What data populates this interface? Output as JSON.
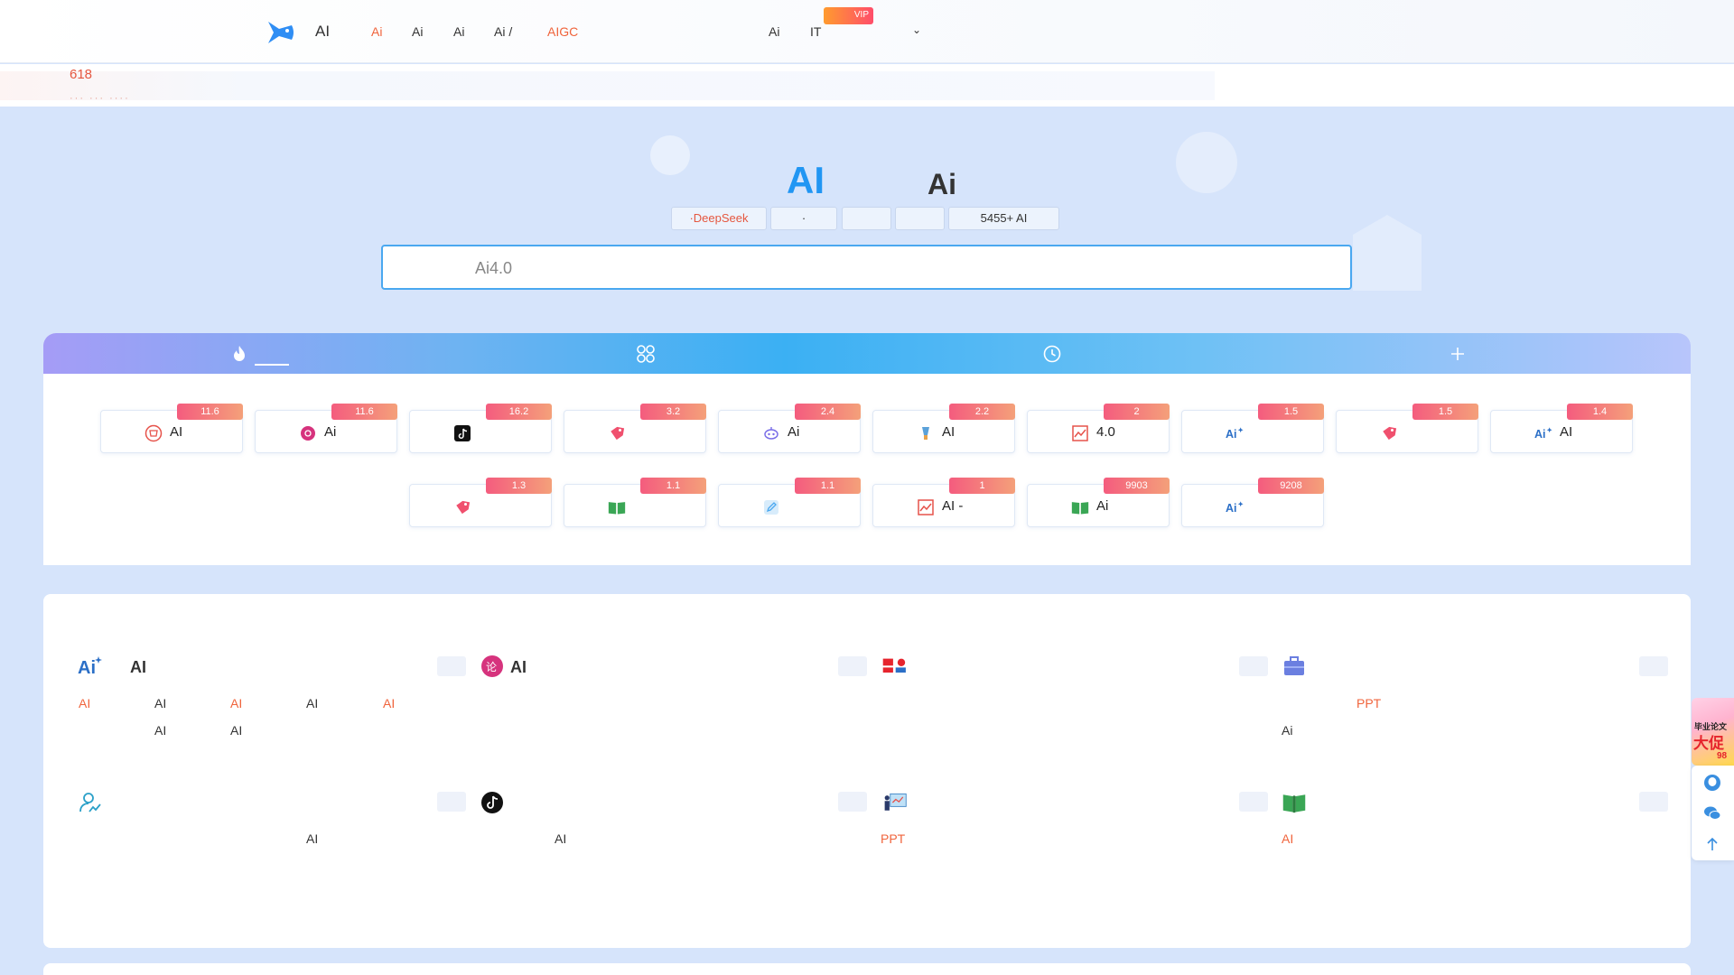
{
  "header": {
    "logo_text": "AI",
    "nav": [
      {
        "label": "Ai",
        "active": true
      },
      {
        "label": "Ai",
        "active": false
      },
      {
        "label": "Ai",
        "active": false
      },
      {
        "label": "Ai  /",
        "active": false
      },
      {
        "label": "AIGC",
        "active": true
      },
      {
        "label": "Ai",
        "active": false
      },
      {
        "label": "IT",
        "active": false
      }
    ],
    "vip_label": "VIP",
    "dropdown_caret": "⌄"
  },
  "notice": {
    "text": "618",
    "subtext": "···  ···  ····"
  },
  "hero": {
    "title_a": "AI",
    "title_b": "Ai",
    "chips": [
      "·DeepSeek",
      "·",
      "",
      "",
      "5455+   AI"
    ],
    "search_placeholder": "Ai4.0"
  },
  "tabs": [
    {
      "name": "hot",
      "icon": "flame-icon"
    },
    {
      "name": "category",
      "icon": "grid-icon"
    },
    {
      "name": "recent",
      "icon": "clock-icon"
    },
    {
      "name": "add",
      "icon": "plus-icon"
    }
  ],
  "tools": [
    {
      "badge": "11.6",
      "icon": "shop-icon",
      "label": "AI",
      "color": "#e6524a"
    },
    {
      "badge": "11.6",
      "icon": "paper-icon",
      "label": "Ai",
      "color": "#d6337d"
    },
    {
      "badge": "16.2",
      "icon": "tiktok-icon",
      "label": "",
      "color": "#111111"
    },
    {
      "badge": "3.2",
      "icon": "tag-icon",
      "label": "",
      "color": "#f0506e"
    },
    {
      "badge": "2.4",
      "icon": "robot-icon",
      "label": "Ai",
      "color": "#7a6ee8"
    },
    {
      "badge": "2.2",
      "icon": "brush-icon",
      "label": "AI",
      "color": "#5aa1d9"
    },
    {
      "badge": "2",
      "icon": "chart-icon",
      "label": "4.0",
      "color": "#e6524a"
    },
    {
      "badge": "1.5",
      "icon": "ai-spark-icon",
      "label": "",
      "color": "#2b6fc7"
    },
    {
      "badge": "1.5",
      "icon": "tag-icon",
      "label": "",
      "color": "#f0506e"
    },
    {
      "badge": "1.4",
      "icon": "ai-spark-icon",
      "label": "AI",
      "color": "#2b6fc7"
    },
    {
      "badge": "1.3",
      "icon": "tag-icon",
      "label": "",
      "color": "#f0506e"
    },
    {
      "badge": "1.1",
      "icon": "book-icon",
      "label": "",
      "color": "#3aa655"
    },
    {
      "badge": "1.1",
      "icon": "edit-icon",
      "label": "",
      "color": "#4aa8f0"
    },
    {
      "badge": "1",
      "icon": "chart-icon",
      "label": "AI    -",
      "color": "#e6524a"
    },
    {
      "badge": "9903",
      "icon": "book-icon",
      "label": "Ai",
      "color": "#3aa655"
    },
    {
      "badge": "9208",
      "icon": "ai-spark-icon",
      "label": "",
      "color": "#2b6fc7"
    }
  ],
  "categories": [
    {
      "title": "AI",
      "icon": "ai-spark-icon",
      "links": [
        {
          "label": "AI",
          "red": true
        },
        {
          "label": "AI",
          "red": false
        },
        {
          "label": "AI",
          "red": true
        },
        {
          "label": "AI",
          "red": false
        },
        {
          "label": "AI",
          "red": true
        },
        {
          "label": "AI",
          "red": false
        },
        {
          "label": "AI",
          "red": false
        }
      ]
    },
    {
      "title": "AI",
      "icon": "paper-icon",
      "links": []
    },
    {
      "title": "",
      "icon": "media-icon",
      "links": []
    },
    {
      "title": "",
      "icon": "briefcase-icon",
      "links": [
        {
          "label": "PPT",
          "red": true
        },
        {
          "label": "Ai",
          "red": false
        }
      ]
    },
    {
      "title": "",
      "icon": "user-chart-icon",
      "links": [
        {
          "label": "AI",
          "red": false
        }
      ]
    },
    {
      "title": "",
      "icon": "tiktok-icon",
      "links": [
        {
          "label": "AI",
          "red": false
        }
      ]
    },
    {
      "title": "",
      "icon": "presentation-icon",
      "links": [
        {
          "label": "PPT",
          "red": true
        }
      ]
    },
    {
      "title": "",
      "icon": "book-icon",
      "links": [
        {
          "label": "AI",
          "red": true
        }
      ]
    }
  ],
  "side": {
    "banner_line1": "毕业论文",
    "banner_line2": "大促",
    "banner_line3": "98"
  }
}
